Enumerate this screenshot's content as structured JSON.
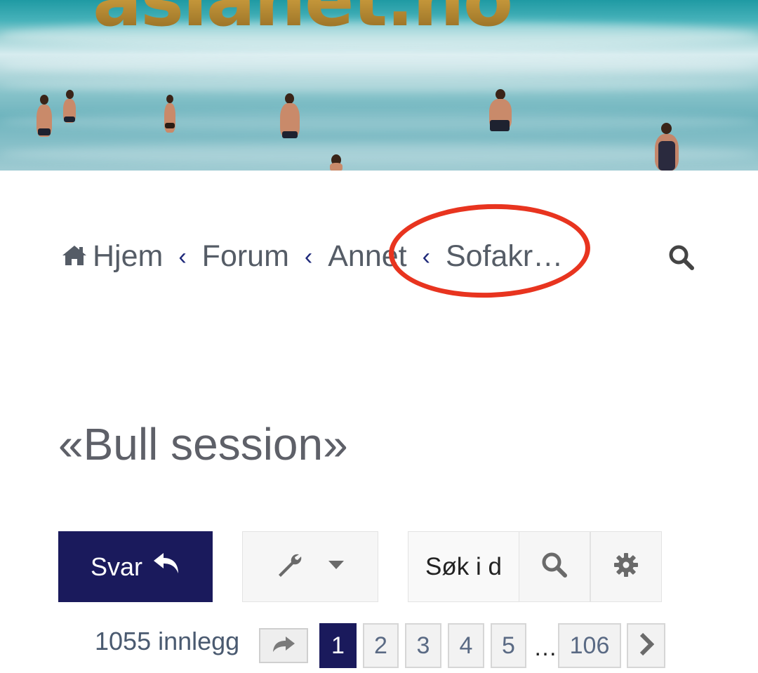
{
  "banner": {
    "logo_text": "asianet.no"
  },
  "breadcrumb": {
    "items": [
      {
        "label": "Hjem",
        "icon": "home-icon"
      },
      {
        "label": "Forum"
      },
      {
        "label": "Annet"
      },
      {
        "label": "Sofakr…"
      }
    ],
    "separator": "‹",
    "search_icon": "search-icon"
  },
  "thread": {
    "title": "«Bull session»"
  },
  "actions": {
    "reply_label": "Svar",
    "reply_icon": "reply-arrow-icon",
    "tools_icon": "wrench-icon",
    "tools_dropdown_icon": "caret-down-icon",
    "search_placeholder": "Søk i d",
    "search_icon": "search-icon",
    "settings_icon": "gear-icon"
  },
  "pagination": {
    "post_count": "1055 innlegg",
    "jump_icon": "share-arrow-icon",
    "pages": [
      "1",
      "2",
      "3",
      "4",
      "5"
    ],
    "current_page": "1",
    "ellipsis": "…",
    "last_page": "106",
    "next_icon": "chevron-right-icon"
  },
  "colors": {
    "primary": "#1a1a5c",
    "annotation": "#e8341f",
    "text_muted": "#5e6068"
  }
}
